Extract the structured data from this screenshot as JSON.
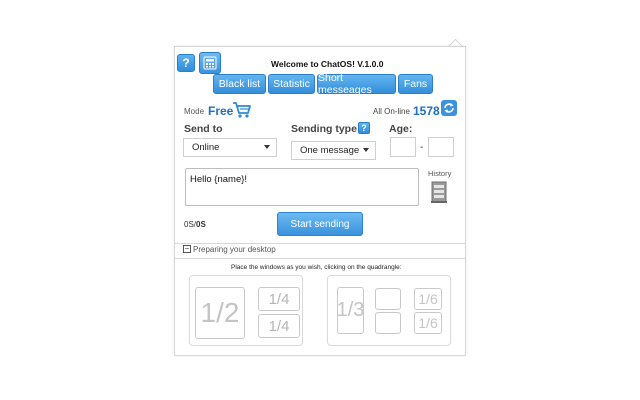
{
  "header": {
    "help_label": "?",
    "title": "Welcome to ChatOS! V.1.0.0"
  },
  "tabs": [
    {
      "label": "Black list"
    },
    {
      "label": "Statistic"
    },
    {
      "label": "Short messeages"
    },
    {
      "label": "Fans"
    }
  ],
  "status": {
    "mode_label": "Mode",
    "mode_value": "Free",
    "online_label": "All On-line",
    "online_count": "1578"
  },
  "form": {
    "send_to_label": "Send to",
    "send_to_value": "Online",
    "sending_type_label": "Sending type",
    "sending_type_help": "?",
    "sending_type_value": "One message",
    "age_label": "Age:",
    "age_from": "",
    "age_separator": "-",
    "age_to": "",
    "message_text": "Hello {name}!",
    "history_label": "History",
    "counter_prefix": "0S/",
    "counter_value": "0S",
    "start_button": "Start sending"
  },
  "desktop": {
    "toggle_symbol": "−",
    "preparing_label": "Preparing your desktop",
    "instruction": "Place the windows as you wish, clicking on the quadrangle:",
    "half": "1/2",
    "quarter": "1/4",
    "third": "1/3",
    "sixth": "1/6"
  },
  "colors": {
    "accent": "#3a93dc",
    "free_mode": "#1e6fbf",
    "cart": "#2d8ad6"
  }
}
